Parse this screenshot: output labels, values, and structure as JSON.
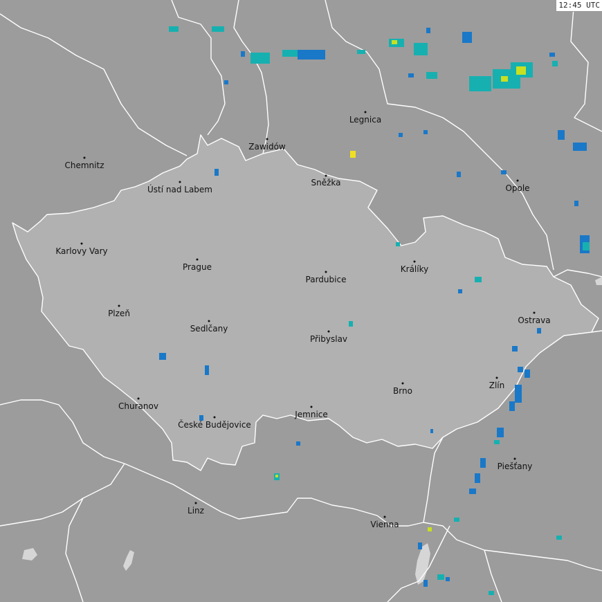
{
  "timestamp": "12:45 UTC",
  "colors": {
    "land": "#9c9c9c",
    "czech_region": "#b1b1b1",
    "border": "#ffffff",
    "water": "#d6d6d6",
    "radar_weak": "#1a78c8",
    "radar_mid": "#17b0b0",
    "radar_strong": "#c8e020",
    "radar_peak": "#f0e020"
  },
  "cities": [
    {
      "name": "Legnica"
    },
    {
      "name": "Zawidów"
    },
    {
      "name": "Chemnitz"
    },
    {
      "name": "Ústí nad Labem"
    },
    {
      "name": "Sněžka"
    },
    {
      "name": "Opole"
    },
    {
      "name": "Karlovy Vary"
    },
    {
      "name": "Prague"
    },
    {
      "name": "Pardubice"
    },
    {
      "name": "Králíky"
    },
    {
      "name": "Plzeň"
    },
    {
      "name": "Ostrava"
    },
    {
      "name": "Sedlčany"
    },
    {
      "name": "Přibyslav"
    },
    {
      "name": "Zlín"
    },
    {
      "name": "Brno"
    },
    {
      "name": "Churanov"
    },
    {
      "name": "České Budějovice"
    },
    {
      "name": "Jemnice"
    },
    {
      "name": "Piešťany"
    },
    {
      "name": "Linz"
    },
    {
      "name": "Vienna"
    }
  ]
}
